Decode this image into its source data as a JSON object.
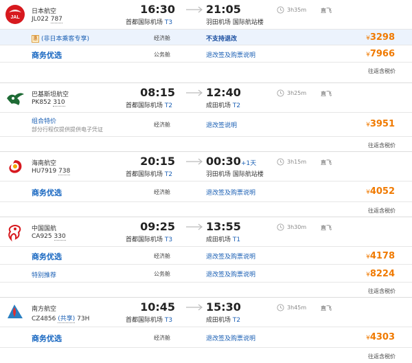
{
  "flights": [
    {
      "airline": "日本航空",
      "flight_no": "JL022",
      "aircraft": "787",
      "shared": "",
      "logo": "jal-crane-icon",
      "dep_time": "16:30",
      "dep_airport": "首都国际机场",
      "dep_terminal": "T3",
      "arr_time": "21:05",
      "arr_plus": "",
      "arr_airport": "羽田机场 国际航站楼",
      "arr_terminal": "",
      "duration": "3h35m",
      "stops": "直飞",
      "fares": [
        {
          "name": "(非日本乘客专享)",
          "cabin": "经济舱",
          "rule": "不支持退改",
          "price": "3298"
        },
        {
          "name": "商务优选",
          "cabin": "公务舱",
          "rule": "退改签及购票说明",
          "price": "7966"
        }
      ],
      "tax_note": "往返含税价"
    },
    {
      "airline": "巴基斯坦航空",
      "flight_no": "PK852",
      "aircraft": "310",
      "shared": "",
      "logo": "pia-logo-icon",
      "dep_time": "08:15",
      "dep_airport": "首都国际机场",
      "dep_terminal": "T2",
      "arr_time": "12:40",
      "arr_plus": "",
      "arr_airport": "成田机场",
      "arr_terminal": "T2",
      "duration": "3h25m",
      "stops": "直飞",
      "fares": [
        {
          "name": "组合特价",
          "sub": "部分行程仅提供提供电子凭证",
          "cabin": "经济舱",
          "rule": "退改签说明",
          "price": "3951"
        }
      ],
      "tax_note": "往返含税价"
    },
    {
      "airline": "海南航空",
      "flight_no": "HU7919",
      "aircraft": "738",
      "shared": "",
      "logo": "hainan-logo-icon",
      "dep_time": "20:15",
      "dep_airport": "首都国际机场",
      "dep_terminal": "T2",
      "arr_time": "00:30",
      "arr_plus": "+1天",
      "arr_airport": "羽田机场 国际航站楼",
      "arr_terminal": "",
      "duration": "3h15m",
      "stops": "直飞",
      "fares": [
        {
          "name": "商务优选",
          "cabin": "经济舱",
          "rule": "退改签及购票说明",
          "price": "4052"
        }
      ],
      "tax_note": "往返含税价"
    },
    {
      "airline": "中国国航",
      "flight_no": "CA925",
      "aircraft": "330",
      "shared": "",
      "logo": "air-china-phoenix-icon",
      "dep_time": "09:25",
      "dep_airport": "首都国际机场",
      "dep_terminal": "T3",
      "arr_time": "13:55",
      "arr_plus": "",
      "arr_airport": "成田机场",
      "arr_terminal": "T1",
      "duration": "3h30m",
      "stops": "直飞",
      "fares": [
        {
          "name": "商务优选",
          "cabin": "经济舱",
          "rule": "退改签及购票说明",
          "price": "4178"
        },
        {
          "name": "特别推荐",
          "cabin": "公务舱",
          "rule": "退改签及购票说明",
          "price": "8224"
        }
      ],
      "tax_note": "往返含税价"
    },
    {
      "airline": "南方航空",
      "flight_no": "CZ4856",
      "aircraft": "73H",
      "shared": "(共享)",
      "logo": "china-southern-kapok-icon",
      "dep_time": "10:45",
      "dep_airport": "首都国际机场",
      "dep_terminal": "T3",
      "arr_time": "15:30",
      "arr_plus": "",
      "arr_airport": "成田机场",
      "arr_terminal": "T2",
      "duration": "3h45m",
      "stops": "直飞",
      "fares": [
        {
          "name": "商务优选",
          "cabin": "经济舱",
          "rule": "退改签及购票说明",
          "price": "4303"
        }
      ],
      "tax_note": "往返含税价"
    }
  ],
  "icons": {
    "arrow": "arrow-right-icon",
    "clock": "clock-icon",
    "badge": "discount-badge-icon"
  },
  "currency": "¥",
  "colors": {
    "price": "#f07a00",
    "link": "#1a5fb4",
    "highlight_bg": "#ecf3fd"
  }
}
